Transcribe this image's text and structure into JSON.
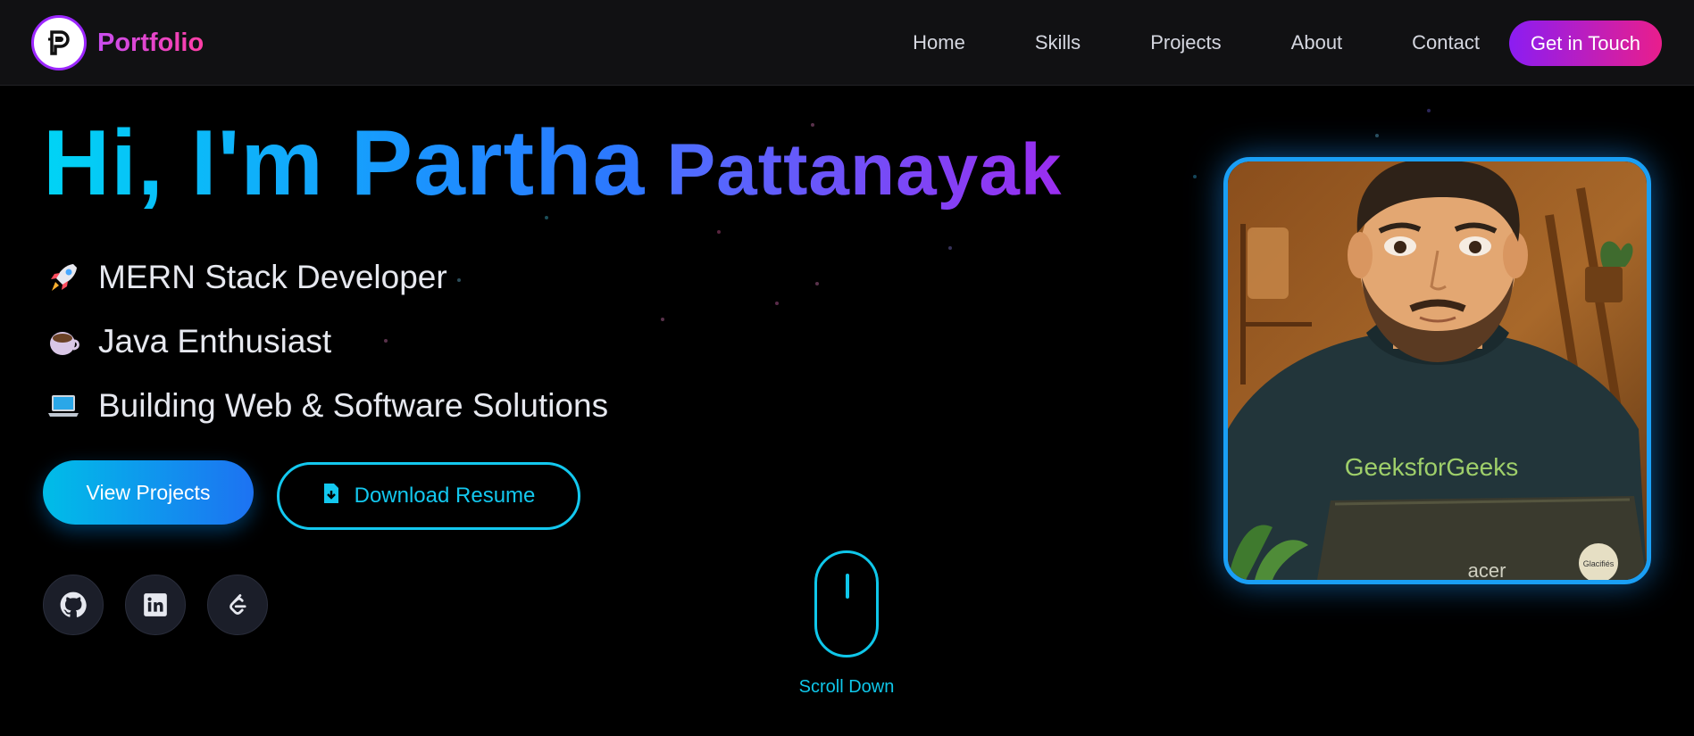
{
  "navbar": {
    "brand": "Portfolio",
    "links": [
      "Home",
      "Skills",
      "Projects",
      "About",
      "Contact"
    ],
    "cta": "Get in Touch"
  },
  "hero": {
    "greeting": "Hi, I'm Partha",
    "surname": "Pattanayak",
    "roles": [
      {
        "icon": "rocket-icon",
        "text": "MERN Stack Developer"
      },
      {
        "icon": "coffee-cup-icon",
        "text": "Java Enthusiast"
      },
      {
        "icon": "laptop-icon",
        "text": "Building Web & Software Solutions"
      }
    ],
    "primary_button": "View Projects",
    "secondary_button": "Download Resume",
    "socials": [
      "github-icon",
      "linkedin-icon",
      "leetcode-icon"
    ],
    "scroll_label": "Scroll Down"
  },
  "avatar": {
    "shirt_text": "GeeksforGeeks",
    "sticker_text": "Glacifiés",
    "laptop_brand": "acer"
  },
  "colors": {
    "accent_cyan": "#13c8ef",
    "accent_blue": "#1d72f2",
    "accent_purple": "#9b2df0",
    "accent_pink": "#e91e8c",
    "background": "#000000",
    "navbar_bg": "#111113"
  }
}
